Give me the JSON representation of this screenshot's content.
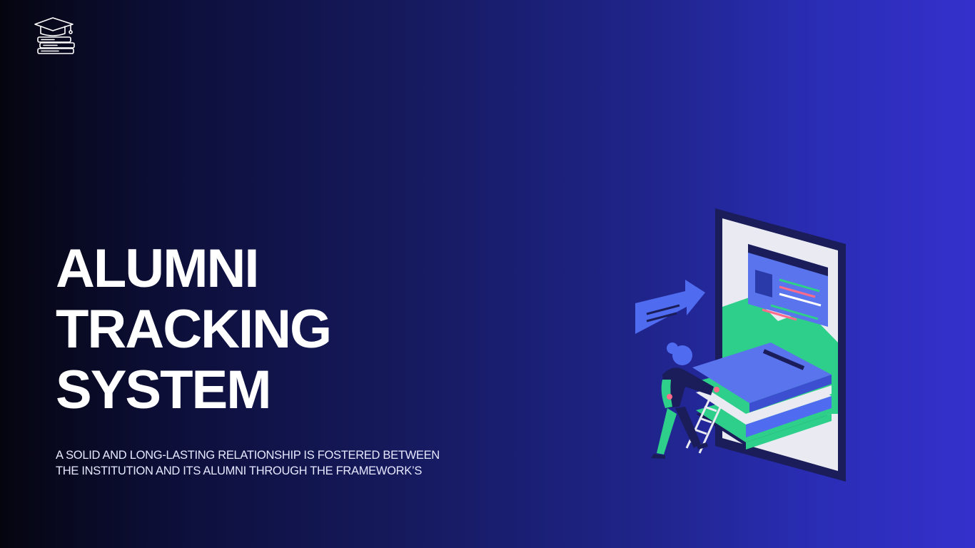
{
  "logo": {
    "icon": "graduation-cap-books-icon",
    "color": "#ffffff"
  },
  "hero": {
    "title_lines": [
      "ALUMNI",
      "TRACKING",
      "SYSTEM"
    ]
  },
  "tagline": {
    "lines": [
      "A SOLID AND LONG-LASTING RELATIONSHIP IS FOSTERED BETWEEN",
      "THE INSTITUTION AND ITS ALUMNI THROUGH THE FRAMEWORK’S"
    ]
  },
  "illustration": {
    "icon": "person-climbing-books-phone-illustration"
  },
  "colors": {
    "background_start": "#050510",
    "background_end": "#3430cc",
    "accent_blue": "#4f6cf0",
    "accent_green": "#2ecf8a",
    "title_text": "#ffffff"
  }
}
